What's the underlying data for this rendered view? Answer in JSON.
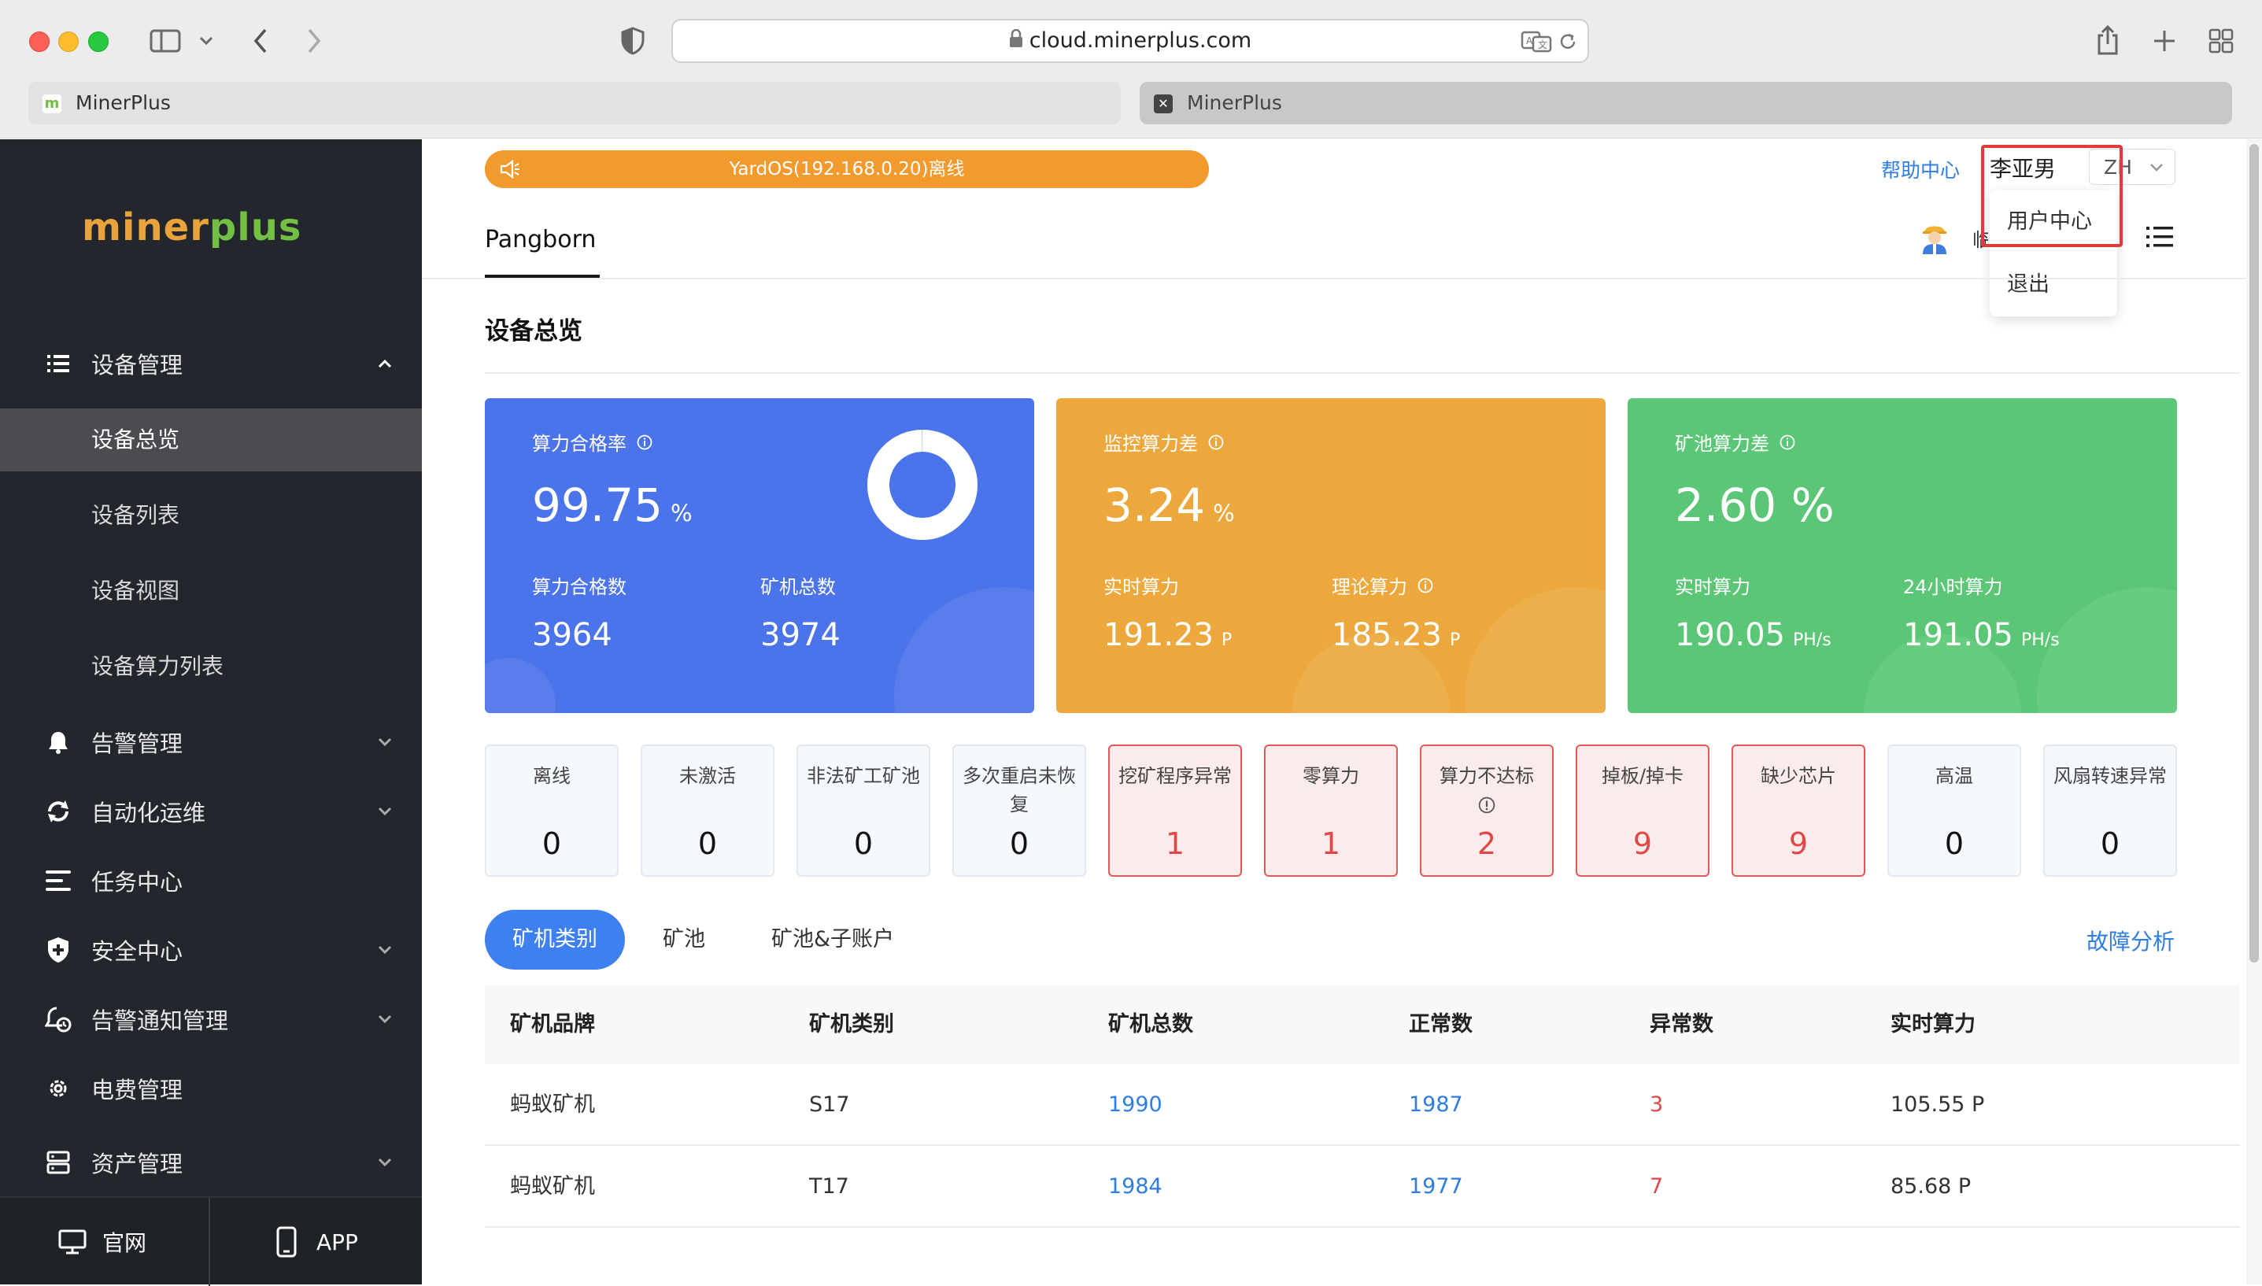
{
  "browser": {
    "url": "cloud.minerplus.com",
    "tabs": [
      {
        "label": "MinerPlus"
      },
      {
        "label": "MinerPlus"
      }
    ]
  },
  "sidebar": {
    "logo_part1": "miner",
    "logo_part2": "plus",
    "device_mgmt": "设备管理",
    "sub_items": [
      "设备总览",
      "设备列表",
      "设备视图",
      "设备算力列表"
    ],
    "items": [
      "告警管理",
      "自动化运维",
      "任务中心",
      "安全中心",
      "告警通知管理",
      "电费管理",
      "资产管理"
    ],
    "bottom": {
      "website": "官网",
      "app": "APP"
    }
  },
  "header": {
    "alert": "YardOS(192.168.0.20)离线",
    "help": "帮助中心",
    "user_name": "李亚男",
    "lang": "ZH",
    "dropdown": [
      "用户中心",
      "退出"
    ],
    "site_tab": "Pangborn",
    "avatar_text": "临"
  },
  "page": {
    "title": "设备总览"
  },
  "cards": {
    "qualified": {
      "title": "算力合格率",
      "value": "99.75",
      "unit": "%",
      "progress": 99.75,
      "l1": "算力合格数",
      "v1": "3964",
      "l2": "矿机总数",
      "v2": "3974"
    },
    "monitor": {
      "title": "监控算力差",
      "value": "3.24",
      "unit": "%",
      "l1": "实时算力",
      "v1": "191.23",
      "u1": "P",
      "l2": "理论算力",
      "v2": "185.23",
      "u2": "P"
    },
    "pool": {
      "title": "矿池算力差",
      "value": "2.60 %",
      "l1": "实时算力",
      "v1": "190.05",
      "u1": "PH/s",
      "l2": "24小时算力",
      "v2": "191.05",
      "u2": "PH/s"
    }
  },
  "stats": [
    {
      "label": "离线",
      "value": "0"
    },
    {
      "label": "未激活",
      "value": "0"
    },
    {
      "label": "非法矿工矿池",
      "value": "0"
    },
    {
      "label": "多次重启未恢复",
      "value": "0"
    },
    {
      "label": "挖矿程序异常",
      "value": "1"
    },
    {
      "label": "零算力",
      "value": "1"
    },
    {
      "label": "算力不达标",
      "value": "2"
    },
    {
      "label": "掉板/掉卡",
      "value": "9"
    },
    {
      "label": "缺少芯片",
      "value": "9"
    },
    {
      "label": "高温",
      "value": "0"
    },
    {
      "label": "风扇转速异常",
      "value": "0"
    }
  ],
  "tabs": [
    "矿机类别",
    "矿池",
    "矿池&子账户"
  ],
  "fault_link": "故障分析",
  "table": {
    "headers": [
      "矿机品牌",
      "矿机类别",
      "矿机总数",
      "正常数",
      "异常数",
      "实时算力"
    ],
    "rows": [
      [
        "蚂蚁矿机",
        "S17",
        "1990",
        "1987",
        "3",
        "105.55 P"
      ],
      [
        "蚂蚁矿机",
        "T17",
        "1984",
        "1977",
        "7",
        "85.68 P"
      ]
    ]
  },
  "colors": {
    "blue_card": "#4b74ea",
    "orange_card": "#eca83d",
    "green_card": "#5bc776",
    "accent": "#3e80f0",
    "error": "#e04848",
    "sidebar": "#23272d"
  }
}
